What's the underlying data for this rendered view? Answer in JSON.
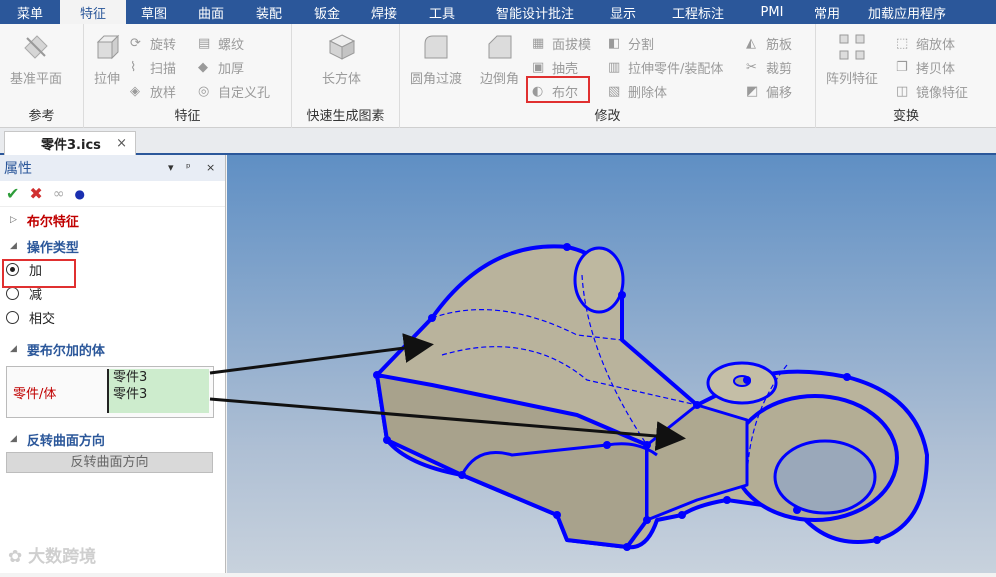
{
  "menubar": {
    "items": [
      "菜单",
      "特征",
      "草图",
      "曲面",
      "装配",
      "钣金",
      "焊接",
      "工具",
      "智能设计批注",
      "显示",
      "工程标注",
      "PMI",
      "常用",
      "加载应用程序"
    ],
    "active_index": 1
  },
  "ribbon": {
    "groups": {
      "reference": {
        "label": "参考",
        "plane": "基准平面"
      },
      "feature": {
        "label": "特征",
        "extrude": "拉伸",
        "revolve": "旋转",
        "sweep": "扫描",
        "loft": "放样",
        "thread": "螺纹",
        "thicken": "加厚",
        "custom_hole": "自定义孔"
      },
      "quick": {
        "label": "快速生成图素",
        "box": "长方体"
      },
      "modify": {
        "label": "修改",
        "fillet": "圆角过渡",
        "chamfer": "边倒角",
        "draft": "面拔模",
        "shell": "抽壳",
        "boolean": "布尔",
        "split": "分割",
        "extrude_part": "拉伸零件/装配体",
        "delete_body": "删除体",
        "rib": "筋板",
        "trim": "裁剪",
        "offset": "偏移"
      },
      "transform": {
        "label": "变换",
        "pattern": "阵列特征",
        "scale": "缩放体",
        "copy": "拷贝体",
        "mirror": "镜像特征"
      }
    }
  },
  "doc_tab": {
    "title": "零件3.ics",
    "close": "×"
  },
  "panel": {
    "title": "属性",
    "pin_ctrl": "▾",
    "pin_icon": "ᵖ",
    "close": "×",
    "section_boolean": "布尔特征",
    "section_op": "操作类型",
    "options": [
      "加",
      "减",
      "相交"
    ],
    "selected_option": 0,
    "section_bodies": "要布尔加的体",
    "bodies_label": "零件/体",
    "bodies": [
      "零件3",
      "零件3"
    ],
    "section_flip": "反转曲面方向",
    "flip_button": "反转曲面方向"
  },
  "watermark": "大数跨境",
  "colors": {
    "brand": "#2b579a",
    "highlight": "#e03030",
    "selection_blue": "#0000ff",
    "model": "#b9b39c"
  }
}
